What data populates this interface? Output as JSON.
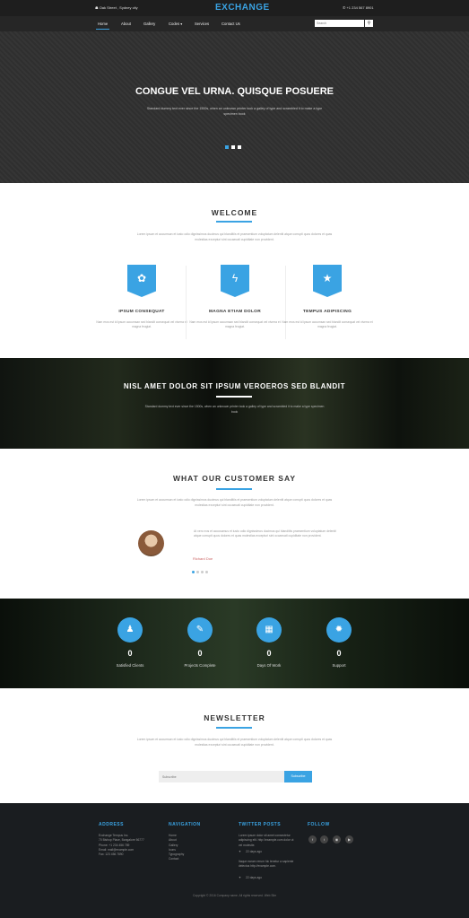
{
  "topbar": {
    "address": "☗ Oak Street , Sydney city",
    "brand": "EXCHANGE",
    "phone": "✆ +1 234 567 8901"
  },
  "nav": {
    "items": [
      "Home",
      "About",
      "Gallery",
      "Codes ▾",
      "Services",
      "Contact Us"
    ],
    "search_placeholder": "Search",
    "search_icon": "search-icon"
  },
  "hero": {
    "title": "CONGUE VEL URNA. QUISQUE POSUERE",
    "subtitle": "Standard dummy text ever since the 1500s, when an unknown printer took a galley of type and scrambled it to make a type specimen book"
  },
  "welcome": {
    "title": "WELCOME",
    "intro": "Lorem ipsum et accumsan et iusto odio dignissimos ducimus qui blanditiis et praesentium voluptatum deleniti atque corrupti quos dolores et quas molestias excepturi sint occaecati cupiditate non provident.",
    "features": [
      {
        "icon": "gear-icon",
        "glyph": "✿",
        "title": "IPSUM CONSEQUAT",
        "text": "Nam eros est id ipsum accumsan sed blandit consequat vel viverra et magna feugiat."
      },
      {
        "icon": "lightning-icon",
        "glyph": "ϟ",
        "title": "MAGNA ETIAM DOLOR",
        "text": "Nam eros est id ipsum accumsan sed blandit consequat vel viverra et magna feugiat."
      },
      {
        "icon": "star-icon",
        "glyph": "★",
        "title": "TEMPUS ADIPISCING",
        "text": "Nam eros est id ipsum accumsan sed blandit consequat vel viverra et magna feugiat."
      }
    ]
  },
  "band1": {
    "title": "NISL AMET DOLOR SIT IPSUM VEROEROS SED BLANDIT",
    "subtitle": "Standard dummy text ever since the 1500s, when an unknown printer took a galley of type and scrambled it to make a type specimen book"
  },
  "testimonials": {
    "title": "WHAT OUR CUSTOMER SAY",
    "intro": "Lorem ipsum et accumsan et iusto odio dignissimos ducimus qui blanditiis et praesentium voluptatum deleniti atque corrupti quos dolores et quas molestias excepturi sint occaecati cupiditate non provident.",
    "quote": "At vero eos et accusamus et iusto odio dignissimos ducimus qui blanditiis praesentium voluptatum deleniti atque corrupti quos dolores et quas molestias excepturi sint occaecati cupiditate non provident.",
    "name": "Richard Doe"
  },
  "stats": [
    {
      "icon": "user-icon",
      "glyph": "♟",
      "value": "0",
      "label": "Satisfied Clients"
    },
    {
      "icon": "document-icon",
      "glyph": "✎",
      "value": "0",
      "label": "Projects Complete"
    },
    {
      "icon": "calendar-icon",
      "glyph": "▦",
      "value": "0",
      "label": "Days Of Work"
    },
    {
      "icon": "support-icon",
      "glyph": "✹",
      "value": "0",
      "label": "Support"
    }
  ],
  "newsletter": {
    "title": "NEWSLETTER",
    "intro": "Lorem ipsum et accumsan et iusto odio dignissimos ducimus qui blanditiis et praesentium voluptatum deleniti atque corrupti quos dolores et quas molestias excepturi sint occaecati cupiditate non provident.",
    "placeholder": "Subscribe",
    "button": "Subscribe"
  },
  "footer": {
    "address_title": "ADDRESS",
    "address_lines": [
      "Exchange Tempus Inc.",
      "70 Bishop Place, Bangalore 56777",
      "Phone: +1 234 456 789",
      "Email: mail@example.com",
      "Fax: 123 456 7890"
    ],
    "nav_title": "NAVIGATION",
    "nav_links": [
      "Home",
      "About",
      "Gallery",
      "Icons",
      "Typography",
      "Contact"
    ],
    "twitter_title": "TWITTER POSTS",
    "tweets": [
      {
        "text": "Lorem ipsum dolor sit amet consectetur adipiscing elit. http://example.com dolor ut vel molestie.",
        "time": "22 days ago"
      },
      {
        "text": "Itaque earum rerum hic tenetur a sapiente delectus http://example.com.",
        "time": "22 days ago"
      }
    ],
    "follow_title": "FOLLOW",
    "social": [
      {
        "icon": "facebook-icon",
        "glyph": "f"
      },
      {
        "icon": "twitter-icon",
        "glyph": "t"
      },
      {
        "icon": "rss-icon",
        "glyph": "◉"
      },
      {
        "icon": "youtube-icon",
        "glyph": "▶"
      }
    ],
    "copyright": "Copyright © 2016 Company name. All rights reserved. Web Site"
  },
  "colors": {
    "accent": "#3aa3e3",
    "dark": "#1a1d20"
  }
}
